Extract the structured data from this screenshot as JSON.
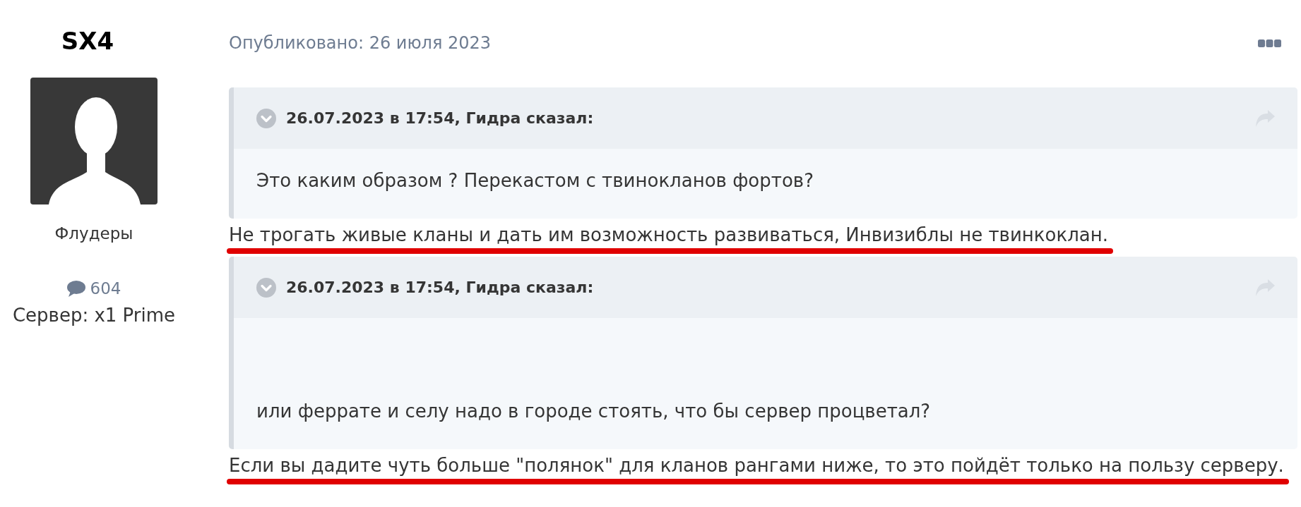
{
  "author": {
    "name": "SX4",
    "group": "Флудеры",
    "post_count": "604",
    "server": "Сервер: x1 Prime"
  },
  "post": {
    "published": "Опубликовано: 26 июля 2023",
    "blocks": [
      {
        "kind": "quote",
        "citation": "26.07.2023 в 17:54, Гидра сказал:",
        "text": "Это каким образом ? Перекастом с твинокланов фортов?"
      },
      {
        "kind": "paragraph",
        "text": "Не трогать живые кланы и дать им возможность развиваться, Инвизиблы не твинкоклан.",
        "underlined": true
      },
      {
        "kind": "quote",
        "citation": "26.07.2023 в 17:54, Гидра сказал:",
        "text": "или феррате и селу надо в городе стоять, что бы сервер процветал?"
      },
      {
        "kind": "paragraph",
        "text": "Если вы дадите чуть больше \"полянок\" для кланов рангами ниже, то это пойдёт только на пользу серверу.",
        "underlined": true
      }
    ]
  }
}
